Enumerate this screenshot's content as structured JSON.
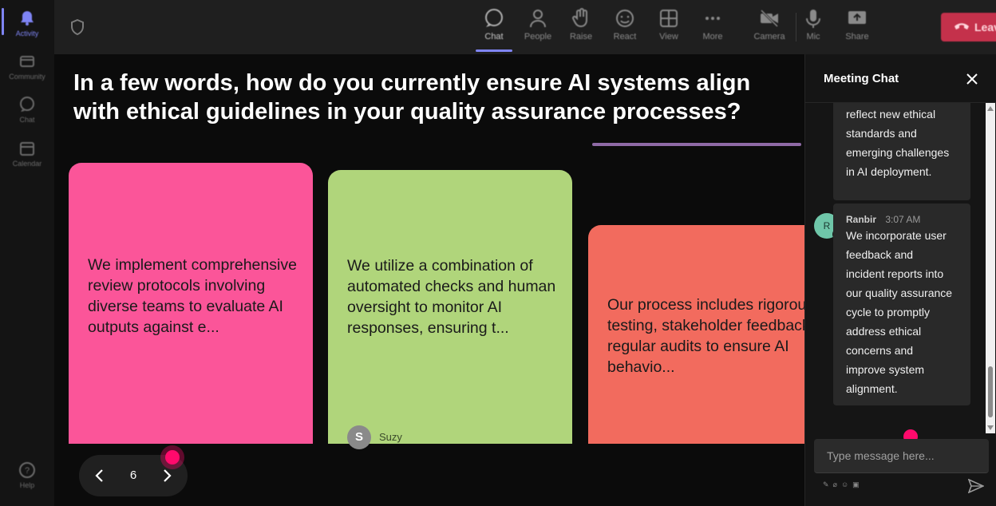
{
  "rail": {
    "items": [
      {
        "label": "Activity",
        "icon": "bell-icon"
      },
      {
        "label": "Community",
        "icon": "community-icon"
      },
      {
        "label": "Chat",
        "icon": "chat-icon"
      },
      {
        "label": "Calendar",
        "icon": "calendar-icon"
      },
      {
        "label": "Help",
        "icon": "help-icon"
      }
    ]
  },
  "toolbar": {
    "chat": "Chat",
    "people": "People",
    "raise": "Raise",
    "react": "React",
    "view": "View",
    "more": "More",
    "camera": "Camera",
    "mic": "Mic",
    "share": "Share",
    "leave": "Leave"
  },
  "question": "In a few words, how do you currently ensure AI systems align with ethical guidelines in your quality assurance processes?",
  "cards": [
    {
      "text": "We implement comprehensive review protocols involving diverse teams to evaluate AI outputs against e...",
      "color": "#fb5599"
    },
    {
      "text": "We utilize a combination of automated checks and human oversight to monitor AI responses, ensuring t...",
      "color": "#b0d57b",
      "author_initial": "S",
      "author": "Suzy"
    },
    {
      "text": "Our process includes rigorous testing, stakeholder feedback, and regular audits to ensure AI behavio...",
      "color": "#f26b5e"
    }
  ],
  "pager": {
    "page": "6"
  },
  "chat": {
    "title": "Meeting Chat",
    "messages": [
      {
        "lines": [
          "reflect new ethical",
          "standards and",
          "emerging challenges",
          "in AI deployment."
        ]
      },
      {
        "avatar": "R",
        "author": "Ranbir",
        "time": "3:07 AM",
        "lines": [
          "We incorporate user",
          "feedback and",
          "incident reports into",
          "our quality assurance",
          "cycle to promptly",
          "address ethical",
          "concerns and",
          "improve system",
          "alignment."
        ]
      }
    ],
    "input_placeholder": "Type message here..."
  },
  "colors": {
    "accent": "#7f85f5",
    "leave": "#c4314b",
    "cursor": "#ff0a6c"
  }
}
